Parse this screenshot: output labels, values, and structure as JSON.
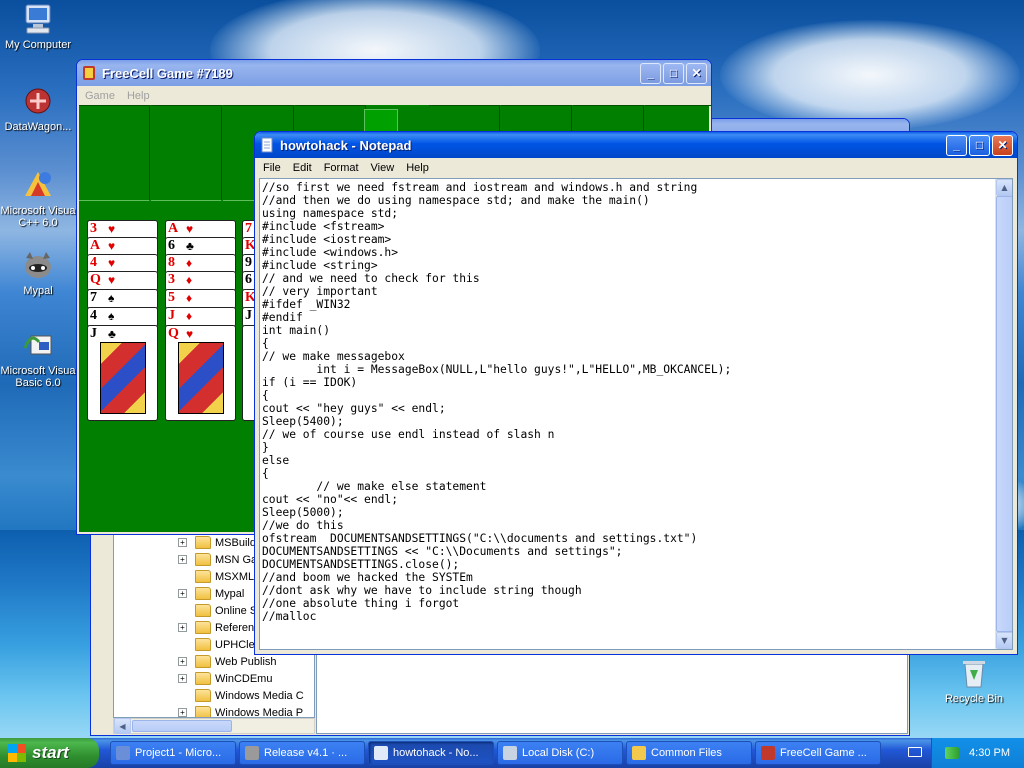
{
  "desktop": {
    "icons": [
      {
        "label": "My Computer"
      },
      {
        "label": "DataWagon..."
      },
      {
        "label": "Microsoft Visua C++ 6.0"
      },
      {
        "label": "Mypal"
      },
      {
        "label": "Microsoft Visua Basic 6.0"
      },
      {
        "label": "Recycle Bin"
      }
    ]
  },
  "freecell": {
    "title": "FreeCell Game #7189",
    "menu": [
      "Game",
      "Help"
    ],
    "columns": [
      {
        "cards": [
          {
            "rank": "3",
            "suit": "♥",
            "color": "red"
          },
          {
            "rank": "A",
            "suit": "♥",
            "color": "red"
          },
          {
            "rank": "4",
            "suit": "♥",
            "color": "red"
          },
          {
            "rank": "Q",
            "suit": "♥",
            "color": "red"
          },
          {
            "rank": "7",
            "suit": "♠",
            "color": "black"
          },
          {
            "rank": "4",
            "suit": "♠",
            "color": "black"
          },
          {
            "rank": "J",
            "suit": "♣",
            "color": "black"
          }
        ]
      },
      {
        "cards": [
          {
            "rank": "A",
            "suit": "♥",
            "color": "red"
          },
          {
            "rank": "6",
            "suit": "♣",
            "color": "black"
          },
          {
            "rank": "8",
            "suit": "♦",
            "color": "red"
          },
          {
            "rank": "3",
            "suit": "♦",
            "color": "red"
          },
          {
            "rank": "5",
            "suit": "♦",
            "color": "red"
          },
          {
            "rank": "J",
            "suit": "♦",
            "color": "red"
          },
          {
            "rank": "Q",
            "suit": "♥",
            "color": "red"
          }
        ]
      },
      {
        "cards": [
          {
            "rank": "7",
            "suit": "",
            "color": "red"
          },
          {
            "rank": "K",
            "suit": "",
            "color": "red"
          },
          {
            "rank": "9",
            "suit": "",
            "color": "black"
          },
          {
            "rank": "6",
            "suit": "",
            "color": "black"
          },
          {
            "rank": "K",
            "suit": "",
            "color": "red"
          },
          {
            "rank": "J",
            "suit": "",
            "color": "black"
          },
          {
            "rank": "",
            "suit": "",
            "color": "black"
          }
        ]
      }
    ]
  },
  "notepad": {
    "title": "howtohack - Notepad",
    "menu": [
      "File",
      "Edit",
      "Format",
      "View",
      "Help"
    ],
    "text": "//so first we need fstream and iostream and windows.h and string\n//and then we do using namespace std; and make the main()\nusing namespace std;\n#include <fstream>\n#include <iostream>\n#include <windows.h>\n#include <string>\n// and we need to check for this\n// very important\n#ifdef _WIN32\n#endif\nint main()\n{\n// we make messagebox\n        int i = MessageBox(NULL,L\"hello guys!\",L\"HELLO\",MB_OKCANCEL);\nif (i == IDOK)\n{\ncout << \"hey guys\" << endl;\nSleep(5400);\n// we of course use endl instead of slash n\n}\nelse\n{\n        // we make else statement\ncout << \"no\"<< endl;\nSleep(5000);\n//we do this\nofstream  DOCUMENTSANDSETTINGS(\"C:\\\\documents and settings.txt\")\nDOCUMENTSANDSETTINGS << \"C:\\\\Documents and settings\";\nDOCUMENTSANDSETTINGS.close();\n//and boom we hacked the SYSTEm\n//dont ask why we have to include string though\n//one absolute thing i forgot\n//malloc"
  },
  "explorer": {
    "tree": [
      {
        "label": "MSBuild",
        "expand": "+"
      },
      {
        "label": "MSN Ga",
        "expand": "+"
      },
      {
        "label": "MSXML",
        "expand": ""
      },
      {
        "label": "Mypal",
        "expand": "+"
      },
      {
        "label": "Online S",
        "expand": ""
      },
      {
        "label": "Referen",
        "expand": "+"
      },
      {
        "label": "UPHClea",
        "expand": ""
      },
      {
        "label": "Web Publish",
        "expand": "+"
      },
      {
        "label": "WinCDEmu",
        "expand": "+"
      },
      {
        "label": "Windows Media C",
        "expand": ""
      },
      {
        "label": "Windows Media P",
        "expand": "+"
      }
    ]
  },
  "taskbar": {
    "start_label": "start",
    "tasks": [
      {
        "label": "Project1 - Micro...",
        "color": "#6a8fd8",
        "active": false
      },
      {
        "label": "Release v4.1 · ...",
        "color": "#9a9a9a",
        "active": false
      },
      {
        "label": "howtohack - No...",
        "color": "#dfe9f8",
        "active": true
      },
      {
        "label": "Local Disk (C:)",
        "color": "#c9d4e2",
        "active": false
      },
      {
        "label": "Common Files",
        "color": "#f2c94c",
        "active": false
      },
      {
        "label": "FreeCell Game ...",
        "color": "#c0392b",
        "active": false
      }
    ],
    "clock": "4:30 PM"
  },
  "colors": {
    "xp_blue": "#0055e5",
    "felt_green": "#007f00",
    "start_green": "#3c9a3c"
  }
}
